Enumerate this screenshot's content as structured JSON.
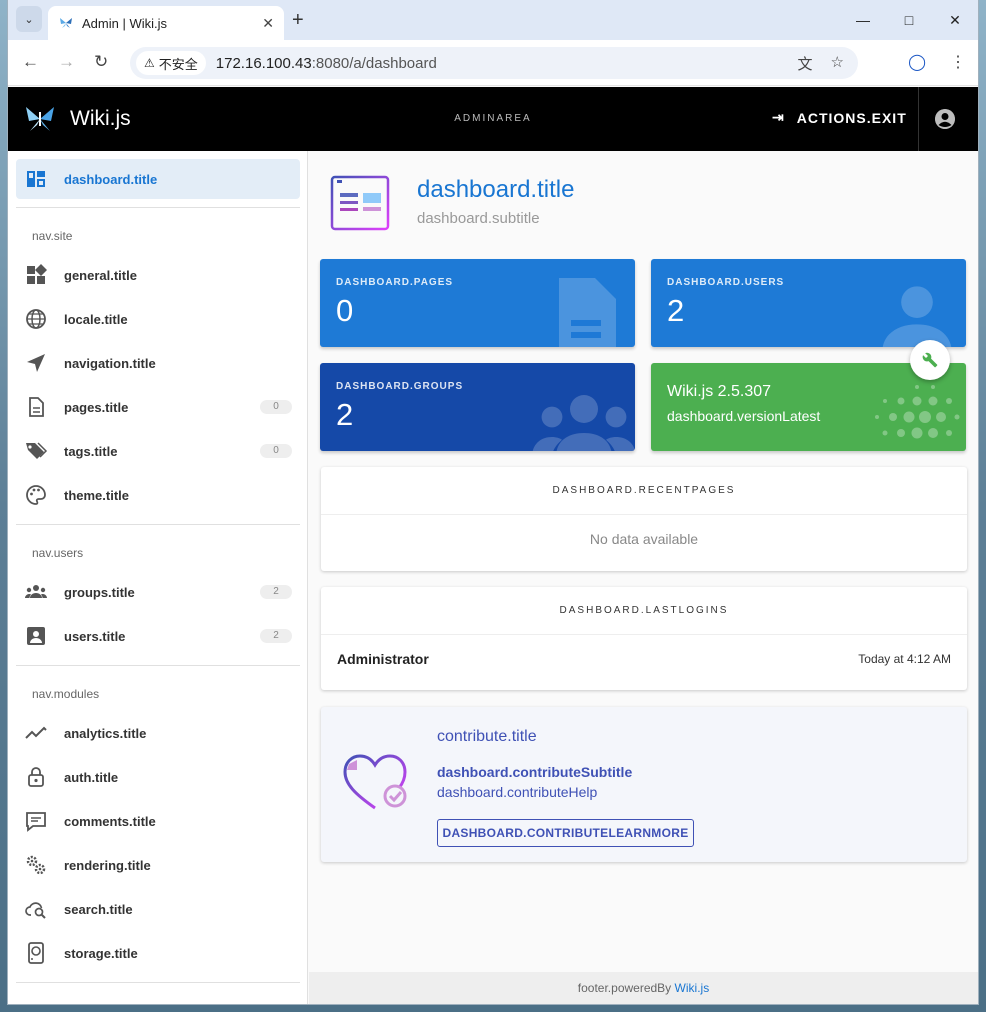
{
  "browser": {
    "tab_title": "Admin | Wiki.js",
    "security_label": "不安全",
    "url_host": "172.16.100.43",
    "url_rest": ":8080/a/dashboard"
  },
  "header": {
    "brand": "Wiki.js",
    "center_label": "ADMINAREA",
    "exit_label": "ACTIONS.EXIT"
  },
  "sidebar": {
    "dashboard": "dashboard.title",
    "site_header": "nav.site",
    "general": "general.title",
    "locale": "locale.title",
    "navigation": "navigation.title",
    "pages": "pages.title",
    "pages_count": "0",
    "tags": "tags.title",
    "tags_count": "0",
    "theme": "theme.title",
    "users_header": "nav.users",
    "groups": "groups.title",
    "groups_count": "2",
    "users": "users.title",
    "users_count": "2",
    "modules_header": "nav.modules",
    "analytics": "analytics.title",
    "auth": "auth.title",
    "comments": "comments.title",
    "rendering": "rendering.title",
    "search": "search.title",
    "storage": "storage.title"
  },
  "main": {
    "title": "dashboard.title",
    "subtitle": "dashboard.subtitle",
    "stats": {
      "pages_label": "DASHBOARD.PAGES",
      "pages_value": "0",
      "users_label": "DASHBOARD.USERS",
      "users_value": "2",
      "groups_label": "DASHBOARD.GROUPS",
      "groups_value": "2",
      "version_title": "Wiki.js 2.5.307",
      "version_sub": "dashboard.versionLatest"
    },
    "recent_pages": {
      "title": "DASHBOARD.RECENTPAGES",
      "empty": "No data available"
    },
    "last_logins": {
      "title": "DASHBOARD.LASTLOGINS",
      "name": "Administrator",
      "time": "Today at 4:12 AM"
    },
    "contribute": {
      "title": "contribute.title",
      "subtitle": "dashboard.contributeSubtitle",
      "help": "dashboard.contributeHelp",
      "button": "DASHBOARD.CONTRIBUTELEARNMORE"
    }
  },
  "footer": {
    "text": "footer.poweredBy",
    "link": "Wiki.js"
  },
  "colors": {
    "primary": "#1976d2",
    "stat_blue": "#1e7ad6",
    "stat_darkblue": "#1549a8",
    "stat_green": "#4caf50",
    "indigo": "#3f51b5"
  }
}
